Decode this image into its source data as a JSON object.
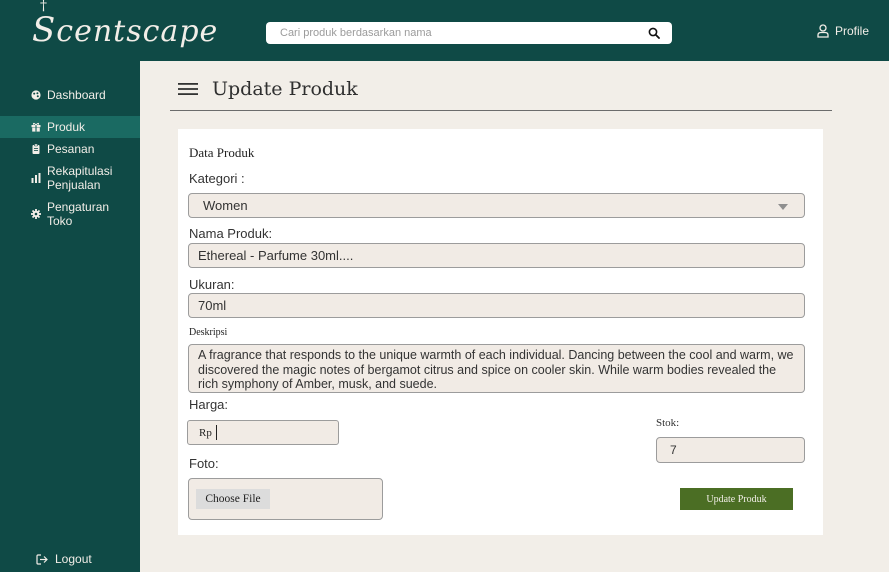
{
  "brand": {
    "name": "Scentscape"
  },
  "search": {
    "placeholder": "Cari produk berdasarkan nama"
  },
  "profile": {
    "label": "Profile"
  },
  "sidebar": {
    "items": [
      {
        "label": "Dashboard",
        "icon": "palette-icon"
      },
      {
        "label": "Produk",
        "icon": "gift-icon"
      },
      {
        "label": "Pesanan",
        "icon": "clipboard-icon"
      },
      {
        "label": "Rekapitulasi\nPenjualan",
        "icon": "bar-chart-icon"
      },
      {
        "label": "Pengaturan\nToko",
        "icon": "gear-icon"
      }
    ],
    "logout_label": "Logout"
  },
  "page": {
    "title": "Update Produk"
  },
  "form": {
    "section_title": "Data Produk",
    "kategori_label": "Kategori :",
    "kategori_value": "Women",
    "nama_label": "Nama Produk:",
    "nama_value": "Ethereal - Parfume 30ml....",
    "ukuran_label": "Ukuran:",
    "ukuran_value": "70ml",
    "deskripsi_label": "Deskripsi",
    "deskripsi_value": "A fragrance that responds to the unique warmth of each individual. Dancing between the cool and warm, we discovered the magic notes of bergamot citrus and spice on cooler skin. While warm bodies revealed the rich symphony of Amber, musk, and suede.",
    "harga_label": "Harga:",
    "harga_prefix": "Rp",
    "stok_label": "Stok:",
    "stok_value": "7",
    "foto_label": "Foto:",
    "choose_file_label": "Choose File",
    "submit_label": "Update Produk"
  },
  "colors": {
    "primary": "#0f4a46",
    "active": "#1a6a62",
    "background": "#f2eee8",
    "button": "#4b6e24"
  }
}
